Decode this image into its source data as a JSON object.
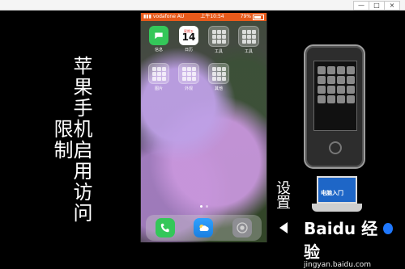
{
  "window": {
    "controls": {
      "minimize": "—",
      "maximize": "□",
      "close": "×"
    }
  },
  "left": {
    "title": "苹果手机启用访问限制"
  },
  "phone": {
    "status": {
      "carrier": "vodafone AU",
      "time": "上午10:54",
      "battery": "79%"
    },
    "apps": [
      {
        "label": "信息"
      },
      {
        "label": "日历",
        "calendar_day": "星期五",
        "calendar_date": "14"
      },
      {
        "label": "工具"
      },
      {
        "label": "工具"
      },
      {
        "label": "图片"
      },
      {
        "label": "外观"
      },
      {
        "label": "其他"
      }
    ],
    "page_dots": {
      "count": 2,
      "active_index": 0
    }
  },
  "right": {
    "label": "设置"
  },
  "laptop": {
    "screen_text": "电脑入门"
  },
  "watermark": {
    "brand": "Baidu 经验",
    "url": "jingyan.baidu.com"
  },
  "colors": {
    "statusbar": "#e75a1b",
    "wm_blue": "#1f78ff"
  }
}
